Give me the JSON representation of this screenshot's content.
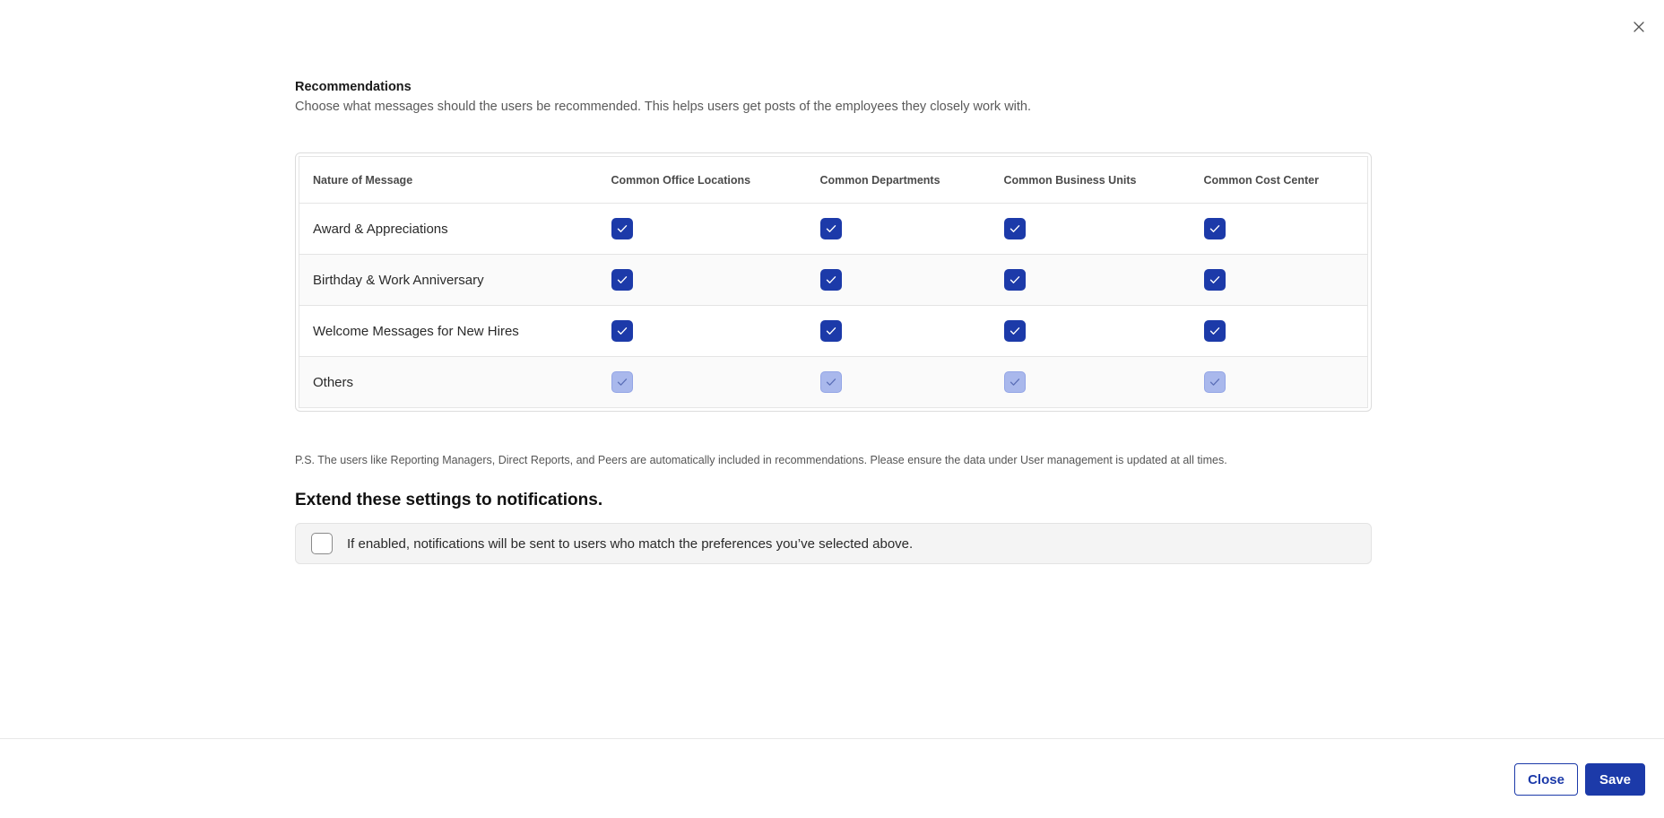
{
  "dialog": {
    "close_icon": "close-icon"
  },
  "recommendations": {
    "title": "Recommendations",
    "description": "Choose what messages should the users be recommended. This helps users get posts of the employees they closely work with."
  },
  "table": {
    "headers": [
      "Nature of Message",
      "Common Office Locations",
      "Common Departments",
      "Common Business Units",
      "Common Cost Center"
    ],
    "rows": [
      {
        "label": "Award & Appreciations",
        "checked": [
          true,
          true,
          true,
          true
        ],
        "disabled": false
      },
      {
        "label": "Birthday & Work Anniversary",
        "checked": [
          true,
          true,
          true,
          true
        ],
        "disabled": false
      },
      {
        "label": "Welcome Messages for New Hires",
        "checked": [
          true,
          true,
          true,
          true
        ],
        "disabled": false
      },
      {
        "label": "Others",
        "checked": [
          true,
          true,
          true,
          true
        ],
        "disabled": true
      }
    ]
  },
  "note": "P.S. The users like Reporting Managers, Direct Reports, and Peers are automatically included in recommendations. Please ensure the data under User management is updated at all times.",
  "notifications": {
    "title": "Extend these settings to notifications.",
    "checkbox_label": "If enabled, notifications will be sent to users who match the preferences you’ve selected above.",
    "checked": false
  },
  "footer": {
    "close_label": "Close",
    "save_label": "Save"
  },
  "colors": {
    "primary": "#1c3aa9",
    "checkbox_disabled": "#a9b8ec"
  }
}
